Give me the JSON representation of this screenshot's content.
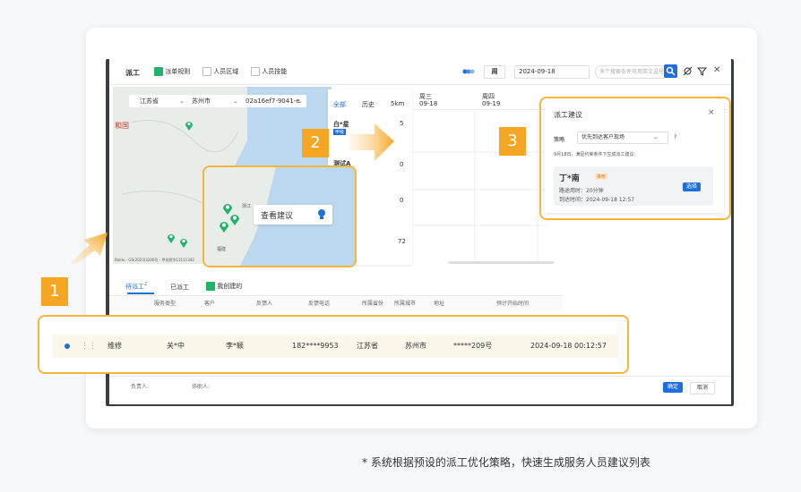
{
  "toolbar": {
    "title": "派工",
    "opt1": "派单规则",
    "opt2": "人员区域",
    "opt3": "人员技能",
    "period": "周",
    "date": "2024-09-18",
    "search_placeholder": "多个搜索条件可用英文逗号"
  },
  "map": {
    "province": "江苏省",
    "city": "苏州市",
    "code": "02a16ef7-9041-e",
    "region_label": "和国",
    "footer": "Baidu - GS(2023)3206号 - 甲测资字11111342",
    "popup_btn": "查看建议",
    "zoom_labels": [
      "浙江",
      "福建"
    ]
  },
  "schedule": {
    "tabs": [
      "全部",
      "历史",
      "5km"
    ],
    "col1": {
      "day": "周三",
      "date": "09-18"
    },
    "col2": {
      "day": "周四",
      "date": "09-19"
    },
    "rows": [
      {
        "name": "白*星",
        "tag": "甲级",
        "val": "5"
      },
      {
        "name": "测试A",
        "tag": "",
        "val": "0"
      },
      {
        "name": "",
        "tag": "",
        "val": "0"
      },
      {
        "name": "",
        "tag": "",
        "val": "72"
      }
    ]
  },
  "suggest": {
    "title": "派工建议",
    "strategy_label": "策略",
    "strategy": "优先到达客户现场",
    "note": "9月18日，满足约束条件下生成派工建议：",
    "person": "丁*南",
    "tag": "推荐",
    "time_label": "路途用时：",
    "time_val": "20分钟",
    "arrive_label": "到达时间：",
    "arrive_val": "2024-09-18 12:57",
    "select_btn": "选择",
    "q": "?"
  },
  "orders": {
    "tabs": [
      "待派工",
      "已派工",
      "我创建的"
    ],
    "tab_count": "2",
    "headers": [
      "服务类型",
      "客户",
      "反馈人",
      "反馈电话",
      "所属省份",
      "所属城市",
      "地址",
      "预计开始时间"
    ],
    "row": [
      "维修",
      "关*中",
      "李*颖",
      "182****9953",
      "江苏省",
      "苏州市",
      "*****209号",
      "2024-09-18 00:12:57"
    ]
  },
  "footer": {
    "owner": "负责人:",
    "assist": "协助人:",
    "ok": "确定",
    "cancel": "取消"
  },
  "badges": [
    "1",
    "2",
    "3"
  ],
  "caption": "* 系统根据预设的派工优化策略，快速生成服务人员建议列表",
  "colors": {
    "accent": "#f5a623",
    "green": "#21b26c",
    "blue": "#1e6fd9"
  }
}
